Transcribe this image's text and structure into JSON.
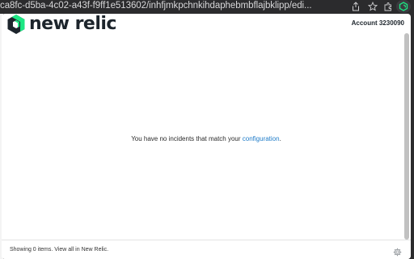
{
  "browser": {
    "url": "ca8fc-d5ba-4c02-a43f-f9ff1e513602/inhfjmkpchnkihdaphebmbflajbklipp/edi..."
  },
  "header": {
    "logo_text": "new relic",
    "account_label": "Account 3230090"
  },
  "main": {
    "message_prefix": "You have no incidents that match your ",
    "message_link": "configuration",
    "message_suffix": "."
  },
  "footer": {
    "status_text": "Showing 0 items. View all in New Relic."
  },
  "colors": {
    "brand_green": "#1ce783",
    "brand_dark": "#1d252c",
    "link": "#1e7bc8"
  },
  "icons": [
    "share-icon",
    "star-icon",
    "puzzle-icon",
    "new-relic-extension-icon",
    "new-relic-logo-icon",
    "gear-icon"
  ]
}
